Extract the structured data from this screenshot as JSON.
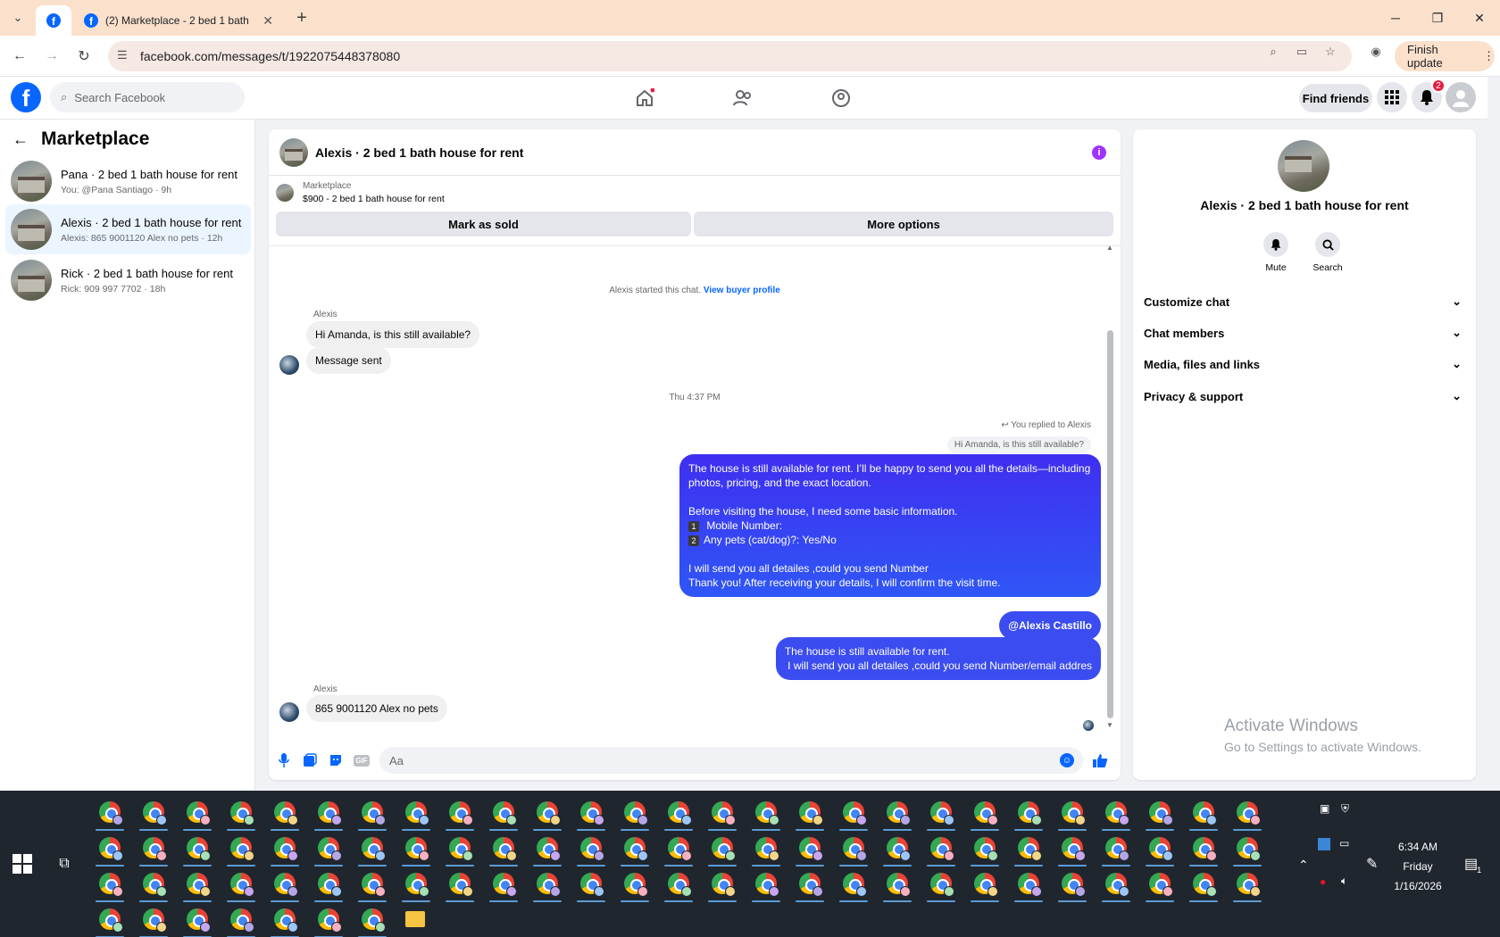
{
  "browser": {
    "tab_title": "(2) Marketplace - 2 bed 1 bath",
    "url": "facebook.com/messages/t/1922075448378080",
    "finish_update": "Finish update"
  },
  "fb_header": {
    "search_placeholder": "Search Facebook",
    "find_friends": "Find friends",
    "notif_count": "2"
  },
  "marketplace": {
    "title": "Marketplace",
    "conversations": [
      {
        "name": "Pana · 2 bed 1 bath house for rent",
        "snippet": "You: @Pana Santiago · 9h"
      },
      {
        "name": "Alexis · 2 bed 1 bath house for rent",
        "snippet": "Alexis: 865 9001120 Alex no pets · 12h"
      },
      {
        "name": "Rick · 2 bed 1 bath house for rent",
        "snippet": "Rick: 909 997 7702 · 18h"
      }
    ]
  },
  "chat": {
    "title": "Alexis · 2 bed 1 bath house for rent",
    "listing_label": "Marketplace",
    "listing_price": "$900 - 2 bed 1 bath house for rent",
    "mark_sold": "Mark as sold",
    "more_options": "More options",
    "started_text": "Alexis started this chat.",
    "view_profile": "View buyer profile",
    "sender1": "Alexis",
    "msg1": "Hi Amanda, is this still available?",
    "msg2": "Message sent",
    "timestamp": "Thu 4:37 PM",
    "replied_label": "You replied to Alexis",
    "reply_quote": "Hi Amanda, is this still available?",
    "out1_lines": [
      "The house is still available for rent. I’ll be happy to send you all the details—including",
      "photos, pricing, and the exact location.",
      "",
      "Before visiting the house, I need some basic information.",
      "Mobile Number:",
      "Any pets (cat/dog)?: Yes/No",
      "",
      "I will send you all detailes ,could you send Number",
      "Thank you! After receiving your details, I will confirm the visit time."
    ],
    "num1": "1",
    "num2": "2",
    "mention": "@Alexis Castillo",
    "out3_line1": "The house is still available for rent.",
    "out3_line2": " I will send you all detailes ,could you send Number/email addres",
    "sender2": "Alexis",
    "msg_last": "865 9001120 Alex no pets",
    "composer_placeholder": "Aa"
  },
  "right_panel": {
    "title": "Alexis · 2 bed 1 bath house for rent",
    "mute": "Mute",
    "search": "Search",
    "rows": [
      "Customize chat",
      "Chat members",
      "Media, files and links",
      "Privacy & support"
    ]
  },
  "watermark": {
    "line1": "Activate Windows",
    "line2": "Go to Settings to activate Windows."
  },
  "taskbar": {
    "time": "6:34 AM",
    "day": "Friday",
    "date": "1/16/2026",
    "notif": "1"
  },
  "colors": {
    "accent": "#0866ff",
    "bubble_out": "#3b4cf0",
    "tab_bar": "#fbe1cc",
    "taskbar": "#20262e"
  }
}
